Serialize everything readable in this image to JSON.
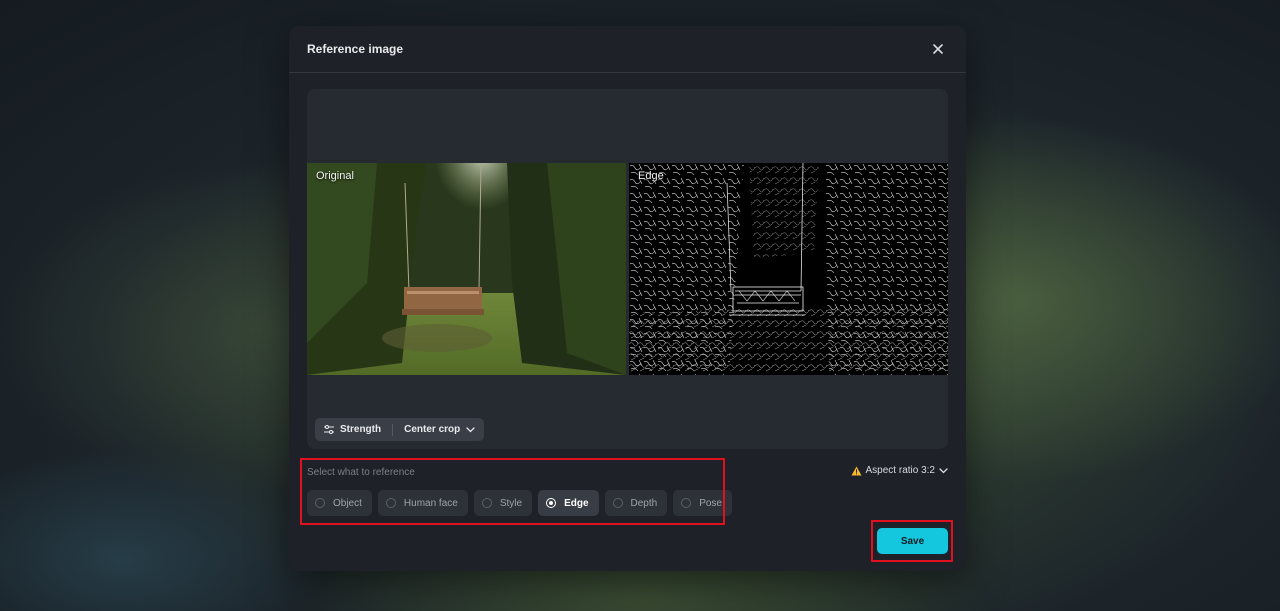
{
  "modal": {
    "title": "Reference image"
  },
  "preview": {
    "original_label": "Original",
    "edge_label": "Edge"
  },
  "toolbar": {
    "strength_label": "Strength",
    "crop_label": "Center crop"
  },
  "reference": {
    "prompt": "Select what to reference",
    "options": [
      {
        "label": "Object",
        "selected": false
      },
      {
        "label": "Human face",
        "selected": false
      },
      {
        "label": "Style",
        "selected": false
      },
      {
        "label": "Edge",
        "selected": true
      },
      {
        "label": "Depth",
        "selected": false
      },
      {
        "label": "Pose",
        "selected": false
      }
    ]
  },
  "aspect": {
    "label": "Aspect ratio 3:2",
    "warning_color": "#f5b82e"
  },
  "actions": {
    "save_label": "Save",
    "accent_color": "#14c6de"
  },
  "icons": {
    "close": "close-icon",
    "sliders": "sliders-icon",
    "chevron": "chevron-down-icon",
    "warning": "warning-icon"
  }
}
